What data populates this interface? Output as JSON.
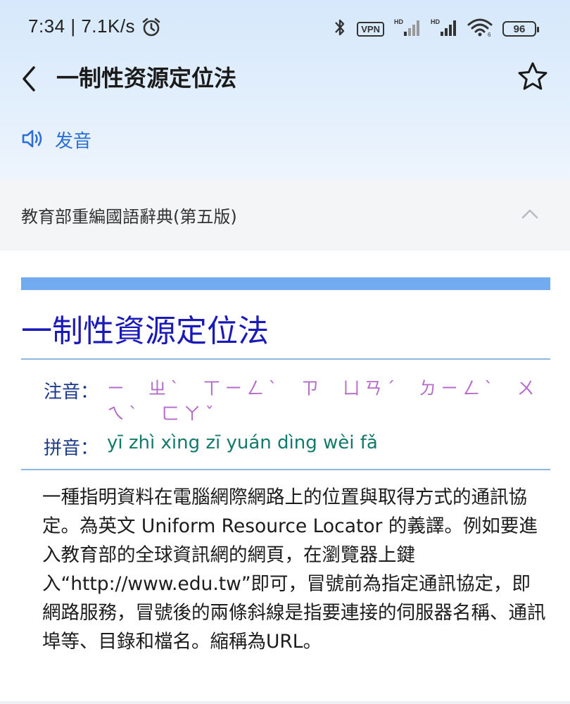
{
  "status_bar": {
    "time": "7:34",
    "speed": "7.1K/s",
    "vpn": "VPN",
    "battery": "96",
    "icons": [
      "alarm-icon",
      "bluetooth-icon",
      "vpn-icon",
      "signal-hd-icon",
      "signal-hd-icon",
      "wifi-icon",
      "battery-icon"
    ]
  },
  "header": {
    "title": "一制性资源定位法",
    "back_icon": "chevron-left-icon",
    "star_icon": "star-outline-icon"
  },
  "pronounce": {
    "label": "发音",
    "icon": "speaker-icon",
    "color": "#2b6fd6"
  },
  "dictionary_section": {
    "name": "教育部重編國語辭典(第五版)",
    "caret_icon": "chevron-up-icon"
  },
  "entry": {
    "word": "一制性資源定位法",
    "zhuyin_label": "注音：",
    "zhuyin": "ㄧ ㄓˋ ㄒㄧㄥˋ ㄗ ㄩㄢˊ ㄉㄧㄥˋ ㄨㄟˋ ㄈㄚˇ",
    "pinyin_label": "拼音：",
    "pinyin": "yī zhì xìng zī yuán dìng wèi fǎ",
    "definition": "一種指明資料在電腦網際網路上的位置與取得方式的通訊協定。為英文 Uniform Resource Locator 的義譯。例如要進入教育部的全球資訊網的網頁，在瀏覽器上鍵入“http://www.edu.tw”即可，冒號前為指定通訊協定，即網路服務，冒號後的兩條斜線是指要連接的伺服器名稱、通訊埠等、目錄和檔名。縮稱為URL。"
  },
  "colors": {
    "accent_blue": "#2b6fd6",
    "word_color": "#1a1ab8",
    "zhuyin_color": "#b36cc9",
    "pinyin_color": "#137a6b",
    "bar_color": "#73abf0"
  }
}
